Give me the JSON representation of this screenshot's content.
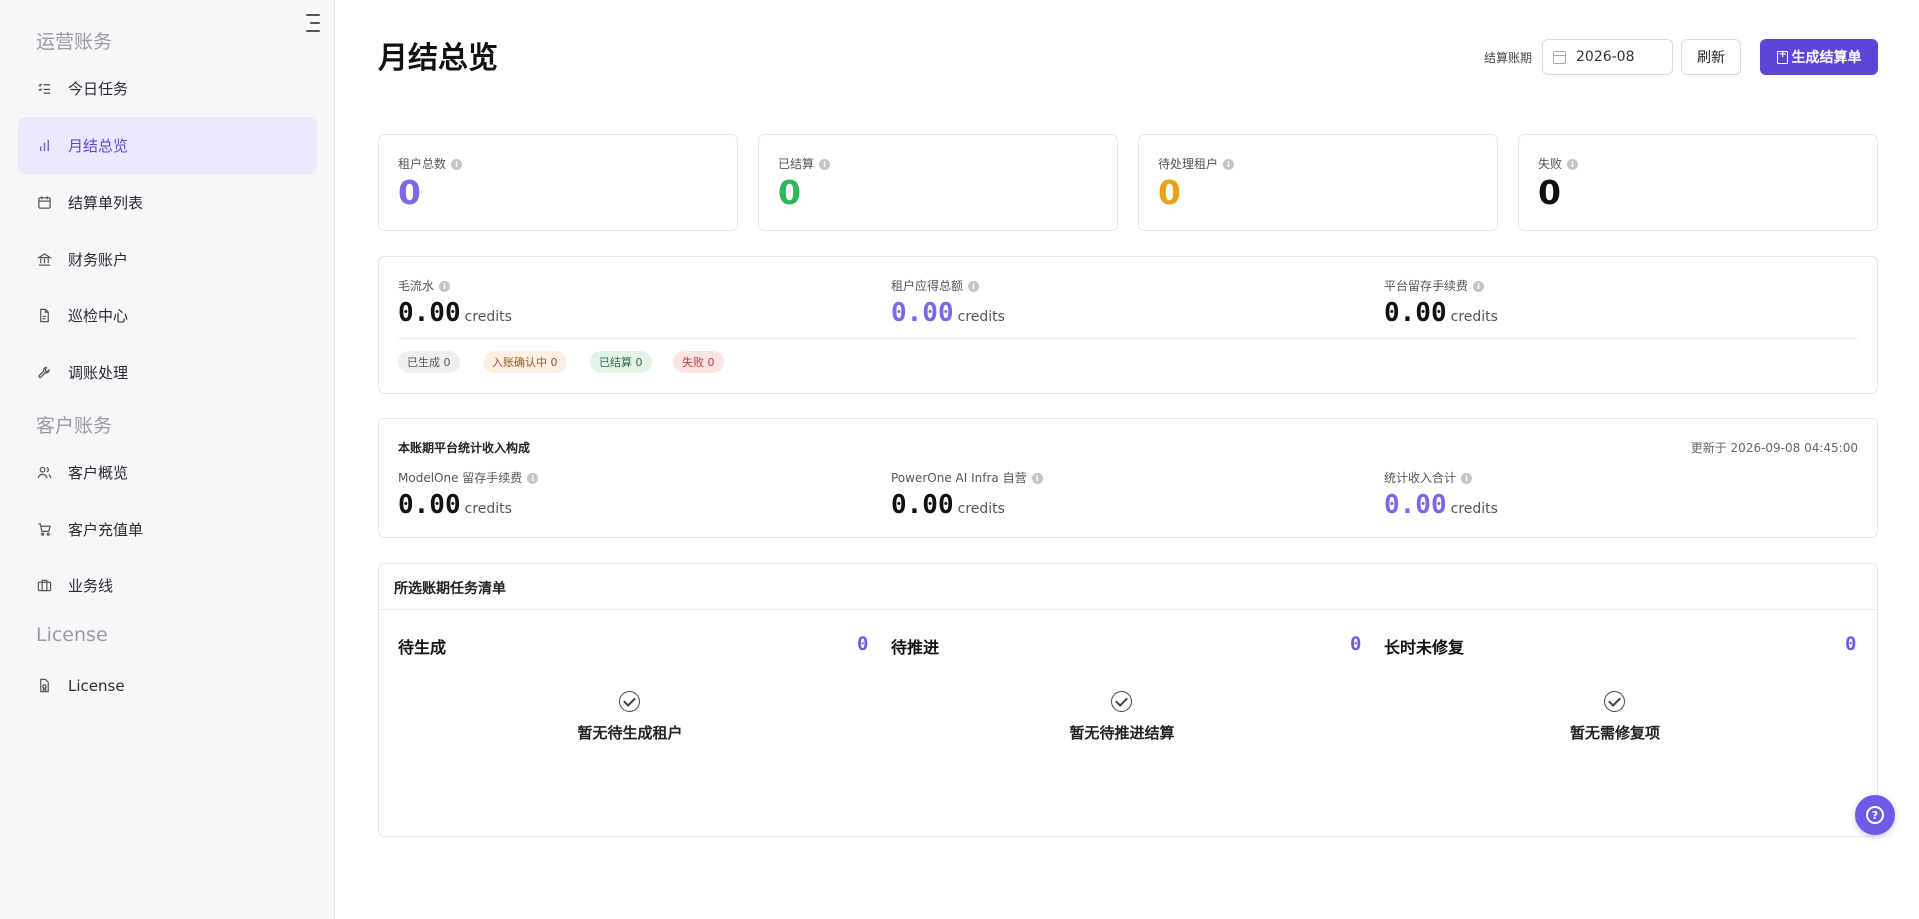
{
  "sidebar": {
    "sections": [
      {
        "title": "运营账务"
      },
      {
        "title": "客户账务"
      },
      {
        "title": "License"
      }
    ],
    "items": [
      {
        "label": "今日任务",
        "icon": "checklist-icon"
      },
      {
        "label": "月结总览",
        "icon": "bar-chart-icon",
        "active": true
      },
      {
        "label": "结算单列表",
        "icon": "calendar-icon"
      },
      {
        "label": "财务账户",
        "icon": "bank-icon"
      },
      {
        "label": "巡检中心",
        "icon": "file-search-icon"
      },
      {
        "label": "调账处理",
        "icon": "wrench-icon"
      },
      {
        "label": "客户概览",
        "icon": "users-icon"
      },
      {
        "label": "客户充值单",
        "icon": "cart-icon"
      },
      {
        "label": "业务线",
        "icon": "briefcase-icon"
      },
      {
        "label": "License",
        "icon": "license-icon"
      }
    ]
  },
  "header": {
    "title": "月结总览",
    "period_label": "结算账期",
    "period_value": "2026-08",
    "refresh_label": "刷新",
    "generate_label": "生成结算单"
  },
  "stats": [
    {
      "label": "租户总数",
      "value": "0",
      "color": "#7b68e8"
    },
    {
      "label": "已结算",
      "value": "0",
      "color": "#2fb55a"
    },
    {
      "label": "待处理租户",
      "value": "0",
      "color": "#e6a21a"
    },
    {
      "label": "失败",
      "value": "0",
      "color": "#111111"
    }
  ],
  "flow": {
    "metrics": [
      {
        "label": "毛流水",
        "value": "0.00",
        "unit": "credits",
        "color": "#111111"
      },
      {
        "label": "租户应得总额",
        "value": "0.00",
        "unit": "credits",
        "color": "#7b68e8"
      },
      {
        "label": "平台留存手续费",
        "value": "0.00",
        "unit": "credits",
        "color": "#111111"
      }
    ],
    "pills": [
      {
        "label": "已生成 0",
        "bg": "#efefef",
        "fg": "#555555"
      },
      {
        "label": "入账确认中 0",
        "bg": "#fdf0e3",
        "fg": "#8a5a2a"
      },
      {
        "label": "已结算 0",
        "bg": "#e4f3e8",
        "fg": "#2e6b3f"
      },
      {
        "label": "失败 0",
        "bg": "#fde4e4",
        "fg": "#c23a3a"
      }
    ]
  },
  "income": {
    "title": "本账期平台统计收入构成",
    "updated": "更新于 2026-09-08 04:45:00",
    "metrics": [
      {
        "label": "ModelOne 留存手续费",
        "value": "0.00",
        "unit": "credits",
        "color": "#111111"
      },
      {
        "label": "PowerOne AI Infra 自营",
        "value": "0.00",
        "unit": "credits",
        "color": "#111111"
      },
      {
        "label": "统计收入合计",
        "value": "0.00",
        "unit": "credits",
        "color": "#7b68e8"
      }
    ]
  },
  "tasks": {
    "title": "所选账期任务清单",
    "columns": [
      {
        "title": "待生成",
        "count": "0",
        "empty": "暂无待生成租户"
      },
      {
        "title": "待推进",
        "count": "0",
        "empty": "暂无待推进结算"
      },
      {
        "title": "长时未修复",
        "count": "0",
        "empty": "暂无需修复项"
      }
    ]
  },
  "help_icon": "question-circle-icon"
}
